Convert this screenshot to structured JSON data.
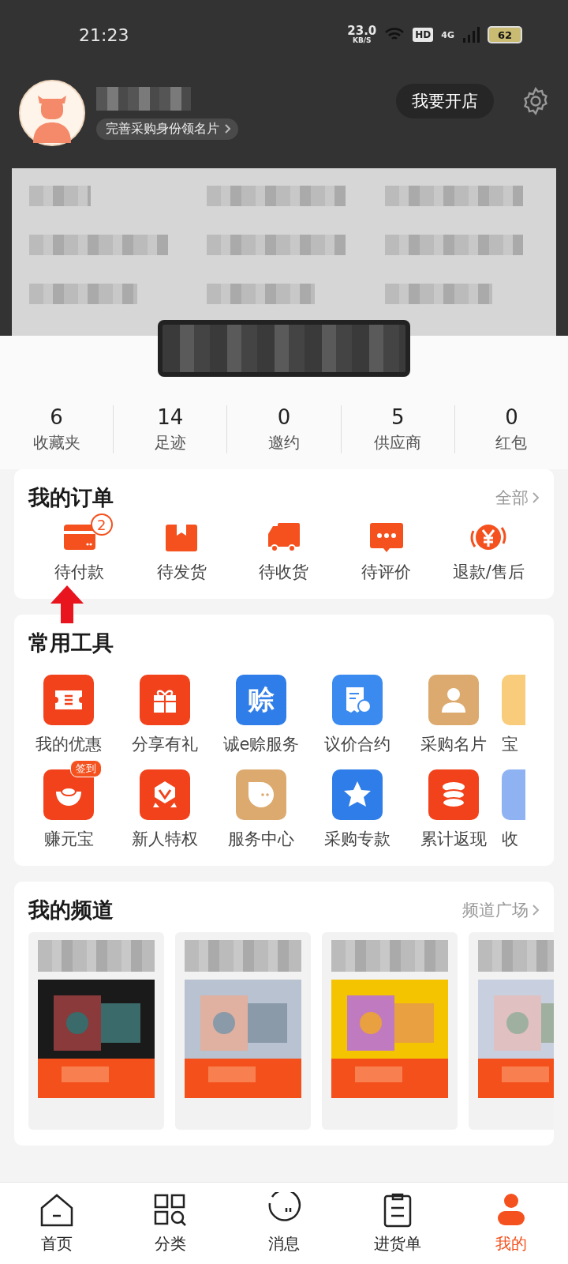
{
  "status_bar": {
    "time": "21:23",
    "speed": "23.0",
    "speed_unit": "KB/S",
    "hd": "HD",
    "network": "4G",
    "battery": "62"
  },
  "profile": {
    "badge_link": "完善采购身份领名片",
    "open_store": "我要开店"
  },
  "stats": [
    {
      "value": "6",
      "label": "收藏夹"
    },
    {
      "value": "14",
      "label": "足迹"
    },
    {
      "value": "0",
      "label": "邀约"
    },
    {
      "value": "5",
      "label": "供应商"
    },
    {
      "value": "0",
      "label": "红包"
    }
  ],
  "orders": {
    "title": "我的订单",
    "more": "全部",
    "items": [
      {
        "kind": "card",
        "label": "待付款",
        "badge": "2"
      },
      {
        "kind": "box",
        "label": "待发货"
      },
      {
        "kind": "truck",
        "label": "待收货"
      },
      {
        "kind": "chat",
        "label": "待评价"
      },
      {
        "kind": "refund",
        "label": "退款/售后"
      }
    ]
  },
  "tools": {
    "title": "常用工具",
    "rows": [
      [
        {
          "kind": "ticket",
          "color": "#f2421b",
          "label": "我的优惠"
        },
        {
          "kind": "gift",
          "color": "#f2421b",
          "label": "分享有礼"
        },
        {
          "kind": "glyph",
          "color": "#2f7de8",
          "label": "诚e赊服务",
          "glyph": "赊"
        },
        {
          "kind": "receipt",
          "color": "#3a8af0",
          "label": "议价合约"
        },
        {
          "kind": "person",
          "color": "#dcaa6e",
          "label": "采购名片"
        },
        {
          "kind": "blank",
          "color": "#f8cc7a",
          "label": "宝"
        }
      ],
      [
        {
          "kind": "ingot",
          "color": "#f2421b",
          "label": "赚元宝",
          "tag": "签到"
        },
        {
          "kind": "medal",
          "color": "#f2421b",
          "label": "新人特权"
        },
        {
          "kind": "bubble",
          "color": "#dcaa6e",
          "label": "服务中心"
        },
        {
          "kind": "star",
          "color": "#2f7de8",
          "label": "采购专款"
        },
        {
          "kind": "coins",
          "color": "#f2421b",
          "label": "累计返现"
        },
        {
          "kind": "blank",
          "color": "#8fb3f2",
          "label": "收"
        }
      ]
    ]
  },
  "channels": {
    "title": "我的频道",
    "more": "频道广场"
  },
  "tab_bar": [
    {
      "kind": "home",
      "label": "首页",
      "selected": false
    },
    {
      "kind": "grid",
      "label": "分类",
      "selected": false
    },
    {
      "kind": "message",
      "label": "消息",
      "selected": false
    },
    {
      "kind": "list",
      "label": "进货单",
      "selected": false
    },
    {
      "kind": "me",
      "label": "我的",
      "selected": true
    }
  ]
}
